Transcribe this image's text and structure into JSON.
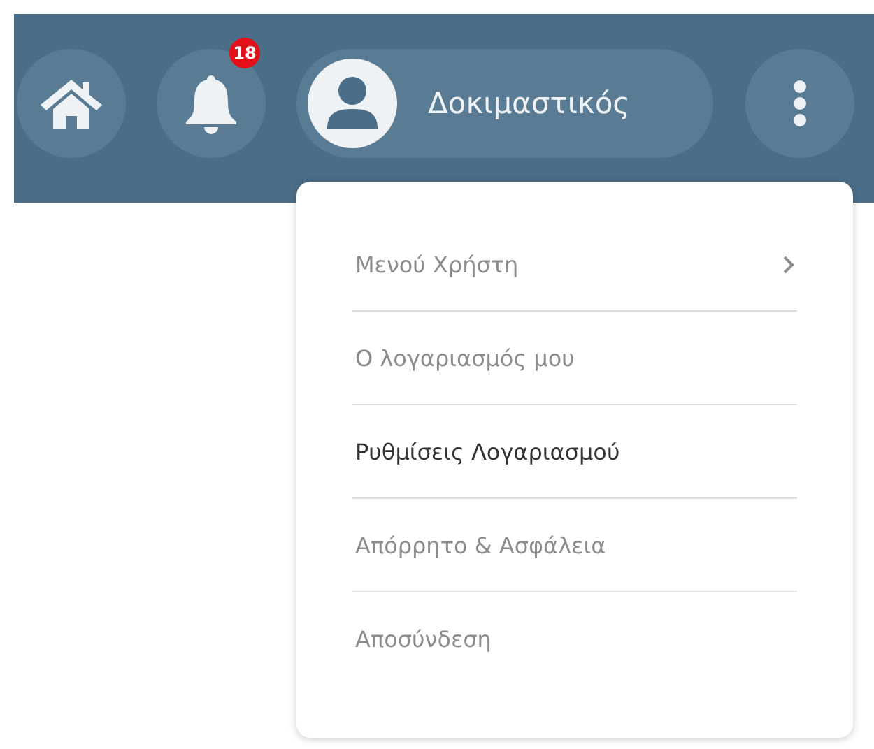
{
  "header": {
    "notifications": {
      "count": "18"
    },
    "user": {
      "name": "Δοκιμαστικός"
    }
  },
  "menu": {
    "items": [
      {
        "label": "Μενού Χρήστη",
        "kind": "submenu",
        "selected": false
      },
      {
        "label": "Ο λογαριασμός μου",
        "kind": "item",
        "selected": false
      },
      {
        "label": "Ρυθμίσεις Λογαριασμού",
        "kind": "item",
        "selected": true
      },
      {
        "label": "Απόρρητο & Ασφάλεια",
        "kind": "item",
        "selected": false
      },
      {
        "label": "Αποσύνδεση",
        "kind": "item",
        "selected": false
      }
    ]
  }
}
